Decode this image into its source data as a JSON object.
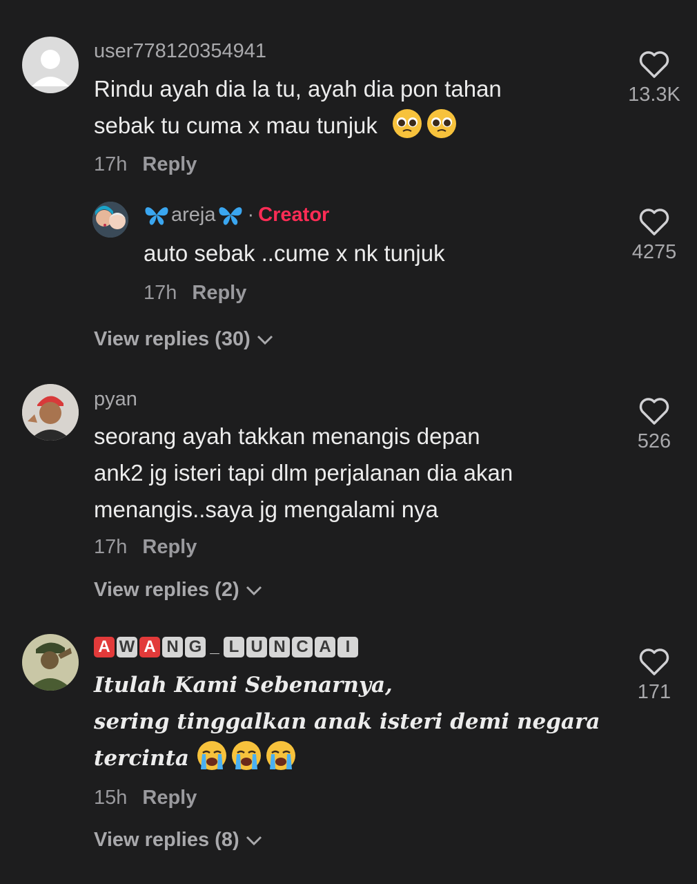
{
  "comments": [
    {
      "username": "user778120354941",
      "text_lines": [
        "Rindu ayah dia la tu, ayah dia pon tahan",
        "sebak tu cuma x mau tunjuk"
      ],
      "emoji": [
        "pleading-face",
        "pleading-face"
      ],
      "time": "17h",
      "reply_label": "Reply",
      "like_count": "13.3K",
      "view_replies": "View replies (30)",
      "reply": {
        "username": "areja",
        "creator_label": "Creator",
        "separator": "·",
        "text": "auto sebak ..cume x nk tunjuk",
        "time": "17h",
        "reply_label": "Reply",
        "like_count": "4275"
      }
    },
    {
      "username": "pyan",
      "text_lines": [
        "seorang ayah takkan menangis depan",
        "ank2 jg isteri tapi dlm perjalanan dia akan",
        "menangis..saya jg mengalami nya"
      ],
      "time": "17h",
      "reply_label": "Reply",
      "like_count": "526",
      "view_replies": "View replies (2)"
    },
    {
      "username_badges": [
        "A",
        "W",
        "A",
        "N",
        "G",
        "_",
        "L",
        "U",
        "N",
        "C",
        "A",
        "I"
      ],
      "text_lines": [
        "Itulah Kami Sebenarnya,",
        "sering tinggalkan anak isteri demi negara",
        "tercinta"
      ],
      "emoji": [
        "crying-face",
        "crying-face",
        "crying-face"
      ],
      "time": "15h",
      "reply_label": "Reply",
      "like_count": "171",
      "view_replies": "View replies (8)"
    }
  ],
  "colors": {
    "background": "#1d1d1e",
    "creator": "#fe2c55",
    "muted": "#a9a9ac"
  },
  "icons": [
    "heart-outline-icon",
    "chevron-down-icon",
    "butterfly-icon",
    "default-avatar-icon"
  ]
}
